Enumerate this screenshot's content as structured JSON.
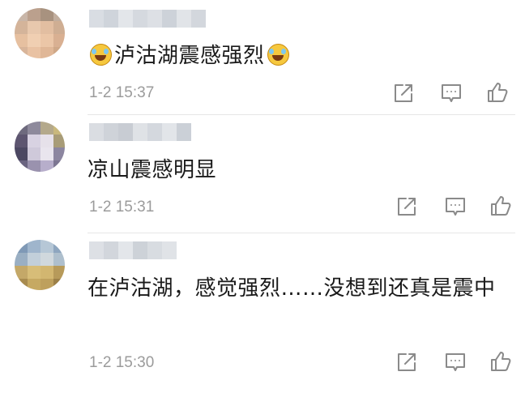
{
  "comments": [
    {
      "text_before": "",
      "text": "泸沽湖震感强烈",
      "text_after": "",
      "time": "1-2 15:37",
      "emoji": "laugh-cry-emoji"
    },
    {
      "text": "凉山震感明显",
      "time": "1-2 15:31"
    },
    {
      "text": "在泸沽湖，感觉强烈……没想到还真是震中",
      "time": "1-2 15:30"
    }
  ],
  "actions": {
    "share_icon": "share-icon",
    "comment_icon": "comment-icon",
    "like_icon": "thumbs-up-icon"
  },
  "colors": {
    "text": "#1a1a1a",
    "meta": "#9b9b9b",
    "icon": "#8a8a8a",
    "divider": "#e6e6e6",
    "emoji": "#f6c83e"
  }
}
